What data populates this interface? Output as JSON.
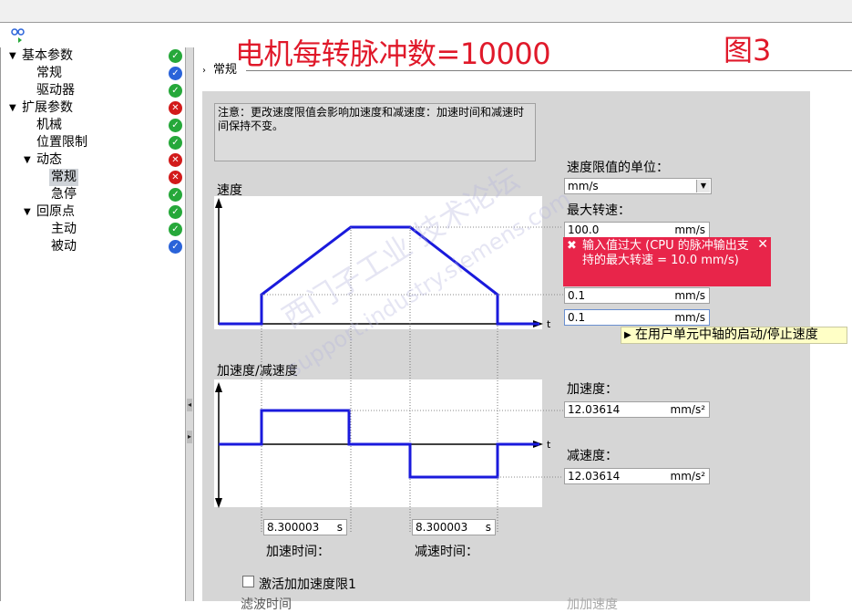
{
  "overlay": {
    "title": "电机每转脉冲数=10000",
    "figure": "图3"
  },
  "tree": {
    "items": [
      {
        "label": "基本参数",
        "status": "ok"
      },
      {
        "label": "常规",
        "status": "info"
      },
      {
        "label": "驱动器",
        "status": "ok"
      },
      {
        "label": "扩展参数",
        "status": "error"
      },
      {
        "label": "机械",
        "status": "ok"
      },
      {
        "label": "位置限制",
        "status": "ok"
      },
      {
        "label": "动态",
        "status": "error"
      },
      {
        "label": "常规",
        "status": "error"
      },
      {
        "label": "急停",
        "status": "ok"
      },
      {
        "label": "回原点",
        "status": "ok"
      },
      {
        "label": "主动",
        "status": "ok"
      },
      {
        "label": "被动",
        "status": "info"
      }
    ]
  },
  "section": {
    "title": "常规"
  },
  "note": "注意：更改速度限值会影响加速度和减速度：加速时间和减速时间保持不变。",
  "speed_unit": {
    "label": "速度限值的单位：",
    "value": "mm/s"
  },
  "max_speed": {
    "label": "最大转速：",
    "value": "100.0",
    "unit": "mm/s"
  },
  "error": {
    "message": "输入值过大 (CPU 的脉冲输出支持的最大转速 = 10.0 mm/s)"
  },
  "start_stop_speed": {
    "value": "0.1",
    "unit": "mm/s"
  },
  "start_stop_speed2": {
    "value": "0.1",
    "unit": "mm/s"
  },
  "tooltip": "在用户单元中轴的启动/停止速度",
  "speed_chart": {
    "title": "速度",
    "t_label": "t"
  },
  "accel_chart": {
    "title": "加速度/减速度",
    "t_label": "t"
  },
  "acceleration": {
    "label": "加速度：",
    "value": "12.03614",
    "unit": "mm/s²"
  },
  "deceleration": {
    "label": "减速度：",
    "value": "12.03614",
    "unit": "mm/s²"
  },
  "accel_time": {
    "label": "加速时间：",
    "value": "8.300003",
    "unit": "s"
  },
  "decel_time": {
    "label": "减速时间：",
    "value": "8.300003",
    "unit": "s"
  },
  "jerk_limit": {
    "label": "激活加加速度限1"
  },
  "cut_labels": {
    "left": "滤波时间",
    "right": "加加速度"
  },
  "watermark": {
    "line1": "西门子工业 技术论坛",
    "line2": "support.industry.siemens.com"
  },
  "colors": {
    "curve": "#1a1adc",
    "error_bg": "#e8254a",
    "overlay": "#e0192a"
  }
}
